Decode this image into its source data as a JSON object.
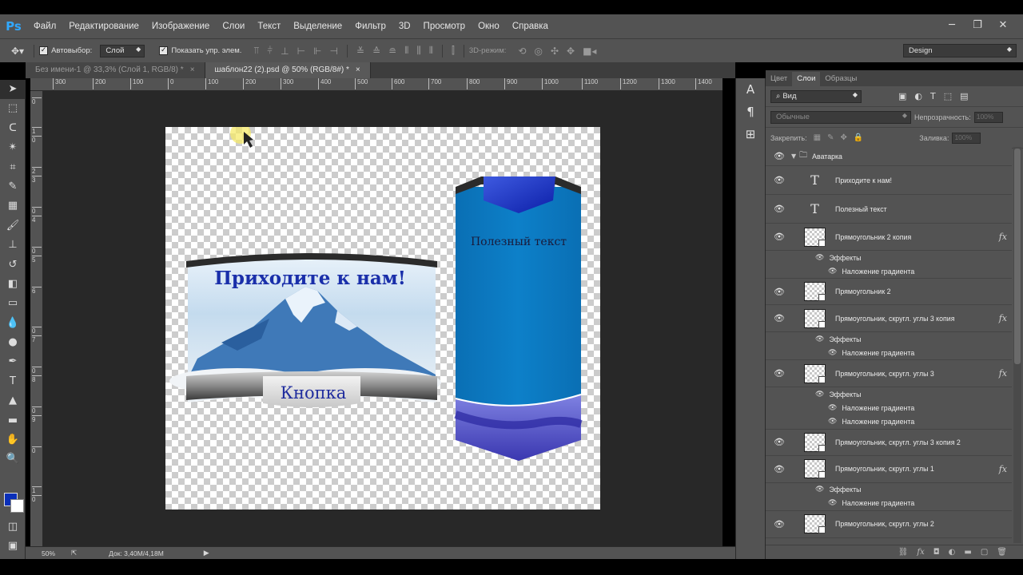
{
  "app": {
    "logo": "Ps"
  },
  "menu": [
    "Файл",
    "Редактирование",
    "Изображение",
    "Слои",
    "Текст",
    "Выделение",
    "Фильтр",
    "3D",
    "Просмотр",
    "Окно",
    "Справка"
  ],
  "window_controls": {
    "minimize": "─",
    "restore": "❐",
    "close": "✕"
  },
  "options": {
    "autoselect_label": "Автовыбор:",
    "autoselect_value": "Слой",
    "show_controls_label": "Показать упр. элем.",
    "mode3d_label": "3D-режим:",
    "workspace": "Design"
  },
  "tabs": [
    {
      "label": "Без имени-1 @ 33,3% (Слой 1, RGB/8) *",
      "close": "×"
    },
    {
      "label": "шаблон22 (2).psd @ 50% (RGB/8#) *",
      "close": "×"
    }
  ],
  "ruler_h": [
    "300",
    "200",
    "100",
    "0",
    "100",
    "200",
    "300",
    "400",
    "500",
    "600",
    "700",
    "800",
    "900",
    "1000",
    "1100",
    "1200",
    "1300",
    "1400"
  ],
  "ruler_v": [
    "0",
    "1",
    "0",
    "2",
    "3",
    "0",
    "4",
    "0",
    "5",
    "6",
    "0",
    "7",
    "0",
    "8",
    "0",
    "9",
    "0",
    "1",
    "0"
  ],
  "canvas": {
    "banner_title": "Приходите к нам!",
    "button_label": "Кнопка",
    "vertical_text": "Полезный текст",
    "colors": {
      "title_blue": "#1a2faa",
      "ribbon_blue": "#0d7ec7",
      "wave_purple": "#5a56c6"
    }
  },
  "status": {
    "zoom": "50%",
    "doc": "Док: 3,40M/4,18M"
  },
  "panel": {
    "tabs": [
      "Цвет",
      "Слои",
      "Образцы"
    ],
    "filter": "Вид",
    "blend": "Обычные",
    "opacity_label": "Непрозрачность:",
    "opacity_value": "100%",
    "lock_label": "Закрепить:",
    "fill_label": "Заливка:",
    "fill_value": "100%",
    "group": "Аватарка",
    "layers": [
      {
        "type": "text",
        "name": "Приходите к нам!"
      },
      {
        "type": "text",
        "name": "Полезный текст"
      },
      {
        "type": "shape",
        "name": "Прямоугольник 2 копия",
        "fx": true,
        "effects": [
          "Наложение градиента"
        ]
      },
      {
        "type": "shape",
        "name": "Прямоугольник 2"
      },
      {
        "type": "shape",
        "name": "Прямоугольник, скругл. углы 3 копия",
        "fx": true,
        "effects": [
          "Наложение градиента"
        ]
      },
      {
        "type": "shape",
        "name": "Прямоугольник, скругл. углы 3",
        "fx": true,
        "effects": [
          "Наложение градиента",
          "Наложение градиента"
        ]
      },
      {
        "type": "shape",
        "name": "Прямоугольник, скругл. углы 3 копия 2"
      },
      {
        "type": "shape",
        "name": "Прямоугольник, скругл. углы 1",
        "fx": true,
        "effects": [
          "Наложение градиента"
        ]
      },
      {
        "type": "shape",
        "name": "Прямоугольник, скругл. углы 2"
      }
    ],
    "effects_label": "Эффекты",
    "fx_label": "fx"
  }
}
